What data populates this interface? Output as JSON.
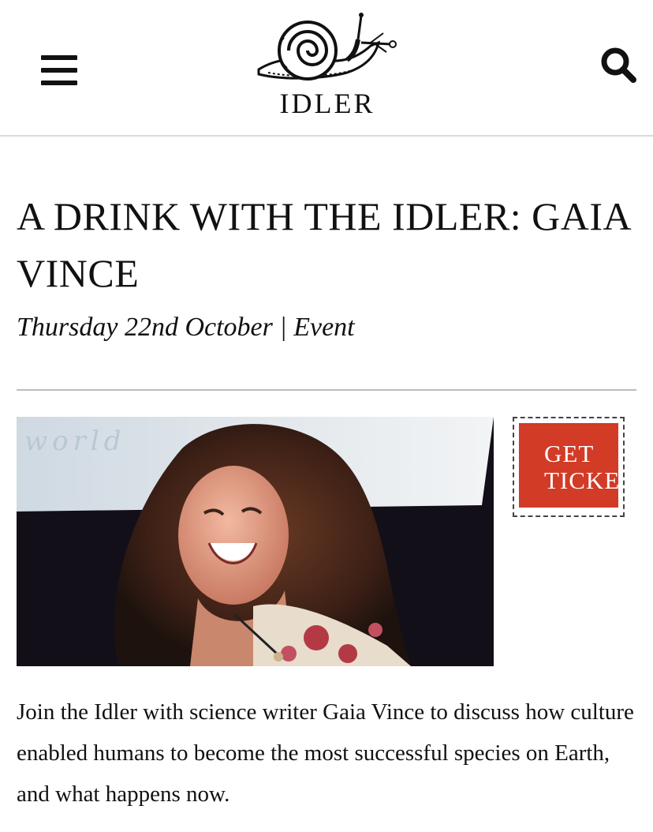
{
  "header": {
    "menu_icon": "hamburger-menu-icon",
    "logo_icon": "snail-icon",
    "logo_text": "IDLER",
    "search_icon": "search-icon"
  },
  "article": {
    "title": "A DRINK WITH THE IDLER: GAIA VINCE",
    "meta": "Thursday 22nd October | Event",
    "image_alt": "Woman with long curly hair laughing on stage",
    "image_backdrop_text": "world",
    "ticket_button": {
      "line1": "GET",
      "line2": "TICKETS"
    },
    "body": "Join the Idler with science writer Gaia Vince to discuss how culture enabled humans to become the most successful species on Earth, and what happens now."
  },
  "colors": {
    "ticket_red": "#d23b26",
    "divider": "#bdbdbd",
    "text": "#111111"
  }
}
